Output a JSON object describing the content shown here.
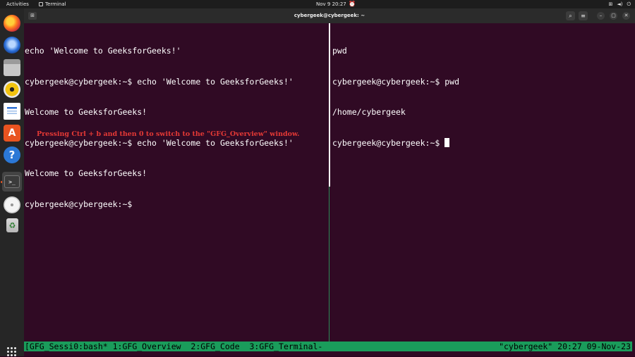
{
  "topbar": {
    "activities": "Activities",
    "app_name": "Terminal",
    "clock": "Nov 9  20:27",
    "icons": [
      "network-icon",
      "volume-icon",
      "power-icon"
    ]
  },
  "dock": {
    "items": [
      "firefox",
      "thunderbird",
      "files",
      "rhythmbox",
      "libreoffice-writer",
      "app-center",
      "help",
      "terminal",
      "dvd",
      "trash"
    ],
    "help_glyph": "?",
    "appcenter_glyph": "A",
    "terminal_glyph": ">_",
    "trash_glyph": "♻"
  },
  "window": {
    "title": "cybergeek@cybergeek: ~"
  },
  "terminal": {
    "left_pane": [
      "echo 'Welcome to GeeksforGeeks!'",
      "cybergeek@cybergeek:~$ echo 'Welcome to GeeksforGeeks!'",
      "Welcome to GeeksforGeeks!",
      "cybergeek@cybergeek:~$ echo 'Welcome to GeeksforGeeks!'",
      "Welcome to GeeksforGeeks!",
      "cybergeek@cybergeek:~$"
    ],
    "right_pane": [
      "pwd",
      "cybergeek@cybergeek:~$ pwd",
      "/home/cybergeek",
      "cybergeek@cybergeek:~$ "
    ],
    "annotation": "Pressing Ctrl  + b and then 0 to switch to the \"GFG_Overview\" window.",
    "status_left": "[GFG_Sessi0:bash* 1:GFG_Overview  2:GFG_Code  3:GFG_Terminal-",
    "status_right": "\"cybergeek\" 20:27 09-Nov-23"
  },
  "colors": {
    "terminal_bg": "#300a24",
    "status_bar": "#1a9c5b",
    "annotation": "#e53935",
    "ubuntu_orange": "#e95420"
  }
}
